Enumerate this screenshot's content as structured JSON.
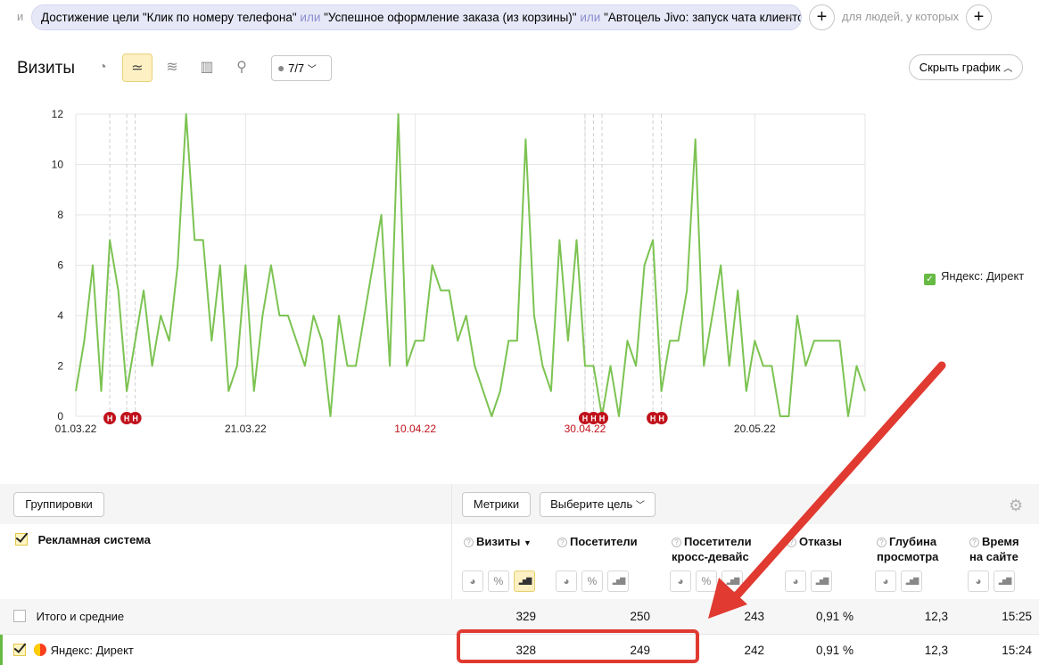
{
  "filter": {
    "prefix": "и",
    "segment_parts": [
      {
        "text": "Достижение цели \"Клик по номеру телефона\"",
        "kind": "cond"
      },
      {
        "text": "или",
        "kind": "or"
      },
      {
        "text": "\"Успешное оформление заказа (из корзины)\"",
        "kind": "cond"
      },
      {
        "text": "или",
        "kind": "or"
      },
      {
        "text": "\"Автоцель Jivo: запуск чата клиентом\"",
        "kind": "cond"
      }
    ],
    "close_glyph": "×",
    "add_glyph": "+",
    "people_label": "для людей, у которых"
  },
  "toolbar": {
    "title": "Визиты",
    "view_icons": [
      {
        "name": "pie-chart-icon",
        "glyph": "◔",
        "active": false
      },
      {
        "name": "line-chart-icon",
        "glyph": "≃",
        "active": true
      },
      {
        "name": "area-chart-icon",
        "glyph": "≋",
        "active": false
      },
      {
        "name": "stacked-bars-icon",
        "glyph": "▥",
        "active": false
      },
      {
        "name": "map-pin-icon",
        "glyph": "⚲",
        "active": false
      }
    ],
    "annotations_label": "7/7",
    "hide_chart_label": "Скрыть график"
  },
  "chart_data": {
    "type": "line",
    "ylim": [
      0,
      12
    ],
    "yticks": [
      0,
      2,
      4,
      6,
      8,
      10,
      12
    ],
    "x_tick_labels": [
      {
        "label": "01.03.22",
        "day_index": 0,
        "holiday": false
      },
      {
        "label": "21.03.22",
        "day_index": 20,
        "holiday": false
      },
      {
        "label": "10.04.22",
        "day_index": 40,
        "holiday": true
      },
      {
        "label": "30.04.22",
        "day_index": 60,
        "holiday": true
      },
      {
        "label": "20.05.22",
        "day_index": 80,
        "holiday": false
      }
    ],
    "x_count": 91,
    "series": [
      {
        "name": "Яндекс: Директ",
        "color": "#7cc352",
        "values": [
          1,
          3,
          6,
          1,
          7,
          5,
          1,
          3,
          5,
          2,
          4,
          3,
          6,
          12,
          7,
          7,
          3,
          6,
          1,
          2,
          6,
          1,
          4,
          6,
          4,
          4,
          3,
          2,
          4,
          3,
          0,
          4,
          2,
          2,
          4,
          6,
          8,
          2,
          12,
          2,
          3,
          3,
          6,
          5,
          5,
          3,
          4,
          2,
          1,
          0,
          1,
          3,
          3,
          11,
          4,
          2,
          1,
          7,
          3,
          7,
          2,
          2,
          0,
          2,
          0,
          3,
          2,
          6,
          7,
          1,
          3,
          3,
          5,
          11,
          2,
          4,
          6,
          2,
          5,
          1,
          3,
          2,
          2,
          0,
          0,
          4,
          2,
          3,
          3,
          3,
          3,
          0,
          2,
          1
        ]
      }
    ],
    "holiday_markers": [
      {
        "day_index": 4,
        "label": "Н"
      },
      {
        "day_index": 6,
        "label": "Н"
      },
      {
        "day_index": 7,
        "label": "Н"
      },
      {
        "day_index": 60,
        "label": "Н"
      },
      {
        "day_index": 61,
        "label": "Н"
      },
      {
        "day_index": 62,
        "label": "Н"
      },
      {
        "day_index": 68,
        "label": "Н"
      },
      {
        "day_index": 69,
        "label": "Н"
      }
    ],
    "grid": true,
    "legend_position": "right"
  },
  "legend": {
    "label": "Яндекс: Директ",
    "color": "#67ba43"
  },
  "table": {
    "groupings_label": "Группировки",
    "metrics_label": "Метрики",
    "goal_select_label": "Выберите цель",
    "dimension_header": "Рекламная система",
    "columns": [
      {
        "line1": "Визиты",
        "line2": "",
        "sorted": true,
        "sort_glyph": "▼",
        "buttons": [
          "pie",
          "percent",
          "bars"
        ],
        "active": "bars"
      },
      {
        "line1": "Посетители",
        "line2": "",
        "sorted": false,
        "sort_glyph": "",
        "buttons": [
          "pie",
          "percent",
          "bars"
        ],
        "active": ""
      },
      {
        "line1": "Посетители",
        "line2": "кросс-девайс",
        "sorted": false,
        "sort_glyph": "",
        "buttons": [
          "pie",
          "percent",
          "bars"
        ],
        "active": ""
      },
      {
        "line1": "Отказы",
        "line2": "",
        "sorted": false,
        "sort_glyph": "",
        "buttons": [
          "pie",
          "bars"
        ],
        "active": ""
      },
      {
        "line1": "Глубина",
        "line2": "просмотра",
        "sorted": false,
        "sort_glyph": "",
        "buttons": [
          "pie",
          "bars"
        ],
        "active": ""
      },
      {
        "line1": "Время",
        "line2": "на сайте",
        "sorted": false,
        "sort_glyph": "",
        "buttons": [
          "pie",
          "bars"
        ],
        "active": ""
      }
    ],
    "rows": [
      {
        "label": "Итого и средние",
        "checked": false,
        "values": [
          "329",
          "250",
          "243",
          "0,91 %",
          "12,3",
          "15:25"
        ]
      },
      {
        "label": "Яндекс: Директ",
        "checked": true,
        "values": [
          "328",
          "249",
          "242",
          "0,91 %",
          "12,3",
          "15:24"
        ]
      }
    ]
  },
  "colors": {
    "accent_yellow": "#fdf0c2",
    "series_green": "#7cc352",
    "holiday_red": "#c0111b",
    "annotation_red": "#e03a31"
  }
}
